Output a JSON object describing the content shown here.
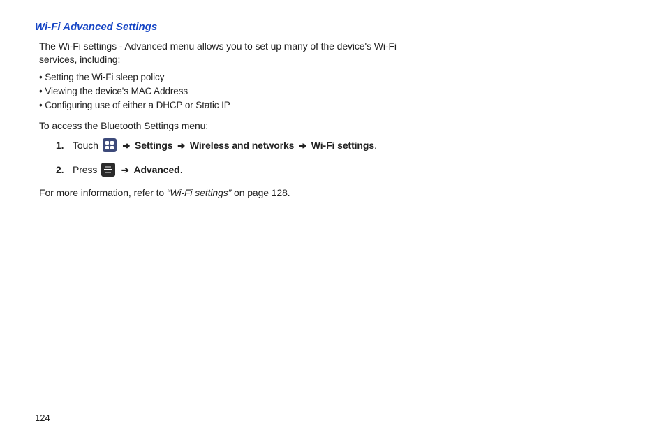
{
  "section_title": "Wi-Fi Advanced Settings",
  "title_color": "#1746c5",
  "intro": "The Wi-Fi settings - Advanced menu allows you to set up many of the device's Wi-Fi services, including:",
  "bullets": [
    "• Setting the Wi-Fi sleep policy",
    "• Viewing the device's MAC Address",
    "• Configuring use of either a DHCP or Static IP"
  ],
  "access_line": "To access the Bluetooth Settings menu:",
  "steps": {
    "s1": {
      "num": "1.",
      "touch": "Touch ",
      "settings": "Settings",
      "wireless": "Wireless and networks",
      "wifi_settings": "Wi-Fi settings",
      "period": "."
    },
    "s2": {
      "num": "2.",
      "press": "Press ",
      "advanced": "Advanced",
      "period": "."
    }
  },
  "arrow": "➔",
  "more_info": {
    "prefix": "For more information, refer to ",
    "ref_quote": "“Wi-Fi settings” ",
    "suffix": " on page 128."
  },
  "page_number": "124"
}
